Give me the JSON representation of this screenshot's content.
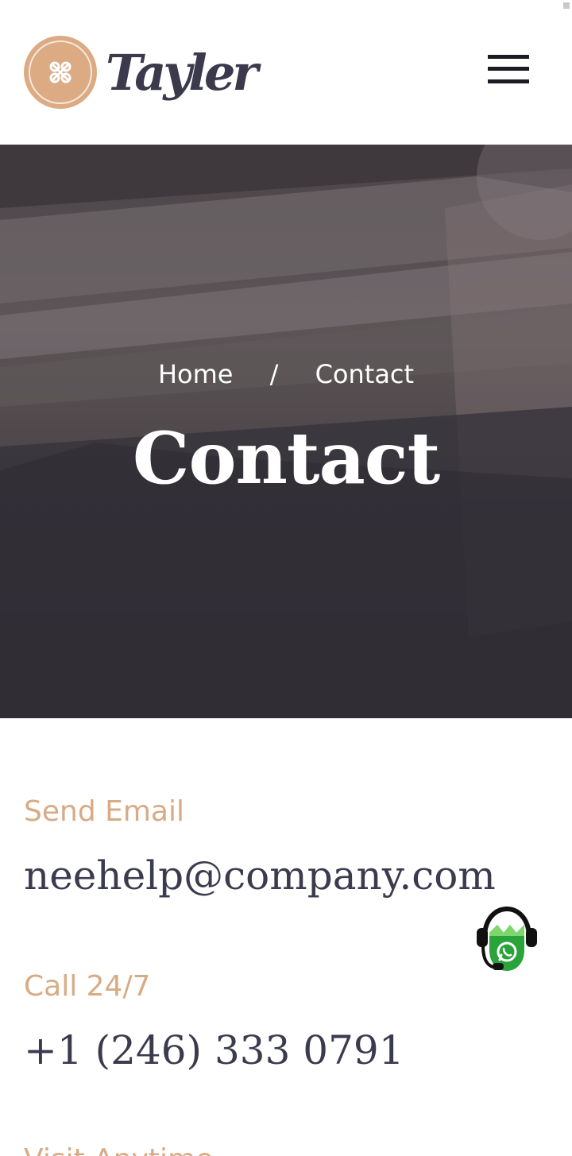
{
  "header": {
    "logo_text": "Tayler",
    "logo_icon": "button-icon",
    "menu_icon": "hamburger-menu-icon"
  },
  "hero": {
    "breadcrumb": {
      "home": "Home",
      "separator": "/",
      "current": "Contact"
    },
    "title": "Contact"
  },
  "contact": {
    "email": {
      "label": "Send Email",
      "value": "neehelp@company.com"
    },
    "phone": {
      "label": "Call 24/7",
      "value": "+1 (246) 333 0791"
    },
    "visit": {
      "label": "Visit Anytime"
    }
  },
  "widgets": {
    "whatsapp_icon": "whatsapp-support-icon"
  },
  "colors": {
    "accent": "#d7ab85",
    "text_dark": "#3b3b4f",
    "logo_badge": "#dcab84"
  }
}
